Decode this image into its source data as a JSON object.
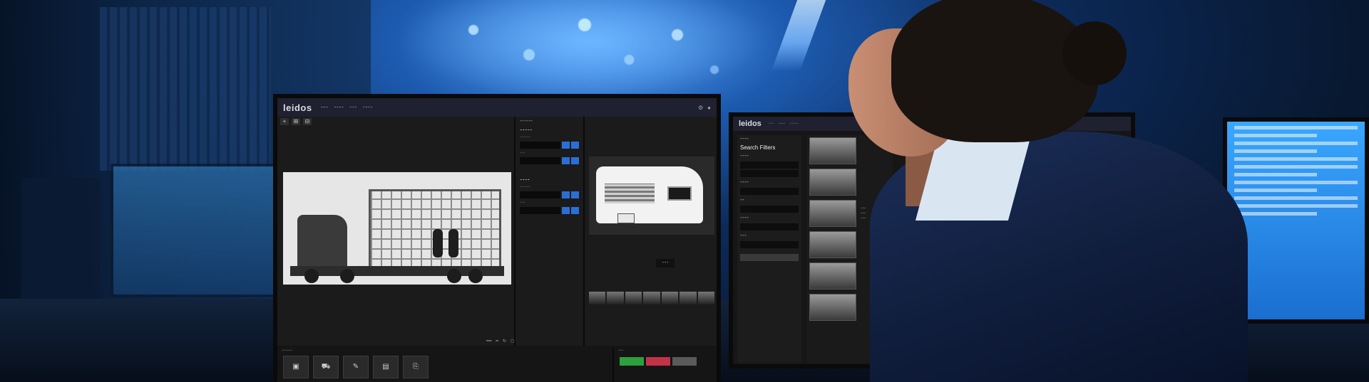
{
  "main_app": {
    "logo": "leidos",
    "nav": [
      "",
      ""
    ],
    "toolbar_icons": [
      "+",
      "⊞",
      "⊟"
    ],
    "detail_tag": "",
    "bottom_icons": [
      "▣",
      "⛟",
      "✎",
      "▤",
      "⎘"
    ],
    "actions": [
      {
        "label": "",
        "color": "#2e9e3e"
      },
      {
        "label": "",
        "color": "#c2334a"
      },
      {
        "label": "",
        "color": "#5a5a5a"
      }
    ]
  },
  "side_app": {
    "logo": "leidos",
    "search_title": "Search Filters",
    "filters": [
      "",
      "",
      "",
      "",
      ""
    ]
  }
}
